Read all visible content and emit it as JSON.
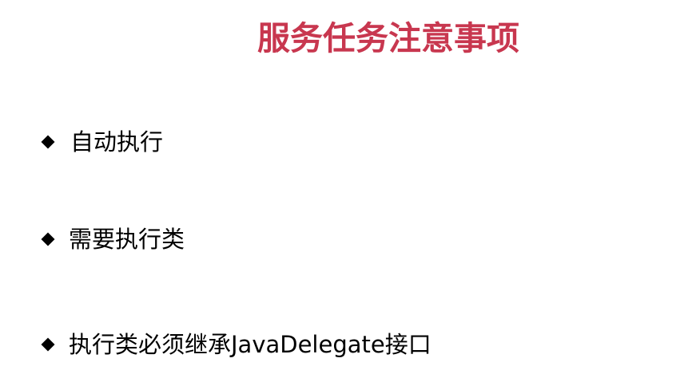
{
  "slide": {
    "title": "服务任务注意事项",
    "title_color": "#c8374f",
    "bullets": [
      {
        "text": "自动执行"
      },
      {
        "text": "需要执行类"
      },
      {
        "text": "执行类必须继承JavaDelegate接口"
      }
    ],
    "bullet_icon": "diamond-bullet-icon"
  }
}
